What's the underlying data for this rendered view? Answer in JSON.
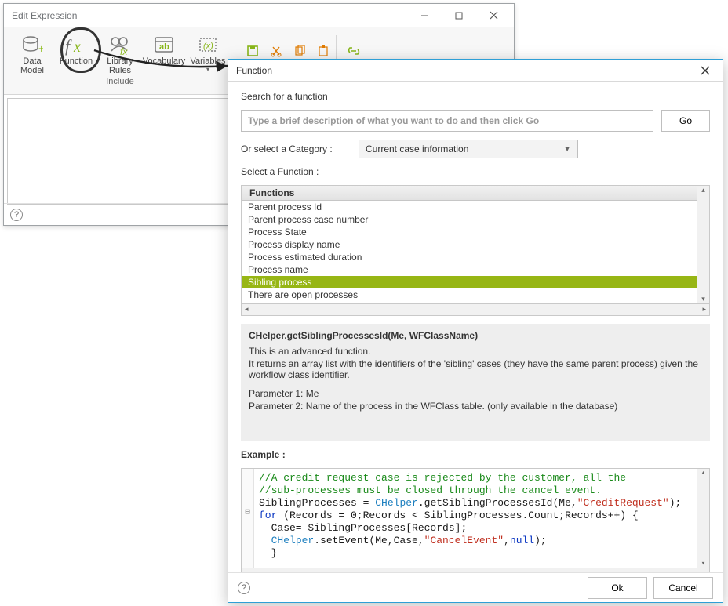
{
  "main_window": {
    "title": "Edit Expression",
    "ribbon_group_label": "Include",
    "items": {
      "data_model": "Data\nModel",
      "function": "Function",
      "library_rules": "Library\nRules",
      "vocabulary": "Vocabulary",
      "variables": "Variables"
    }
  },
  "fn_window": {
    "title": "Function",
    "search_label": "Search for a function",
    "search_placeholder": "Type a brief description of what you want to do and then click Go",
    "go_label": "Go",
    "cat_label": "Or select a Category :",
    "cat_value": "Current case information",
    "select_fn_label": "Select a Function :",
    "list_header": "Functions",
    "functions": [
      "Parent process Id",
      "Parent process case number",
      "Process State",
      "Process display name",
      "Process estimated duration",
      "Process name",
      "Sibling process",
      "There are open processes"
    ],
    "selected_index": 6,
    "desc": {
      "signature": "CHelper.getSiblingProcessesId(Me, WFClassName)",
      "line1": "This is an advanced function.",
      "line2": "It returns an array list with the identifiers of the 'sibling' cases (they have the same parent process) given the workflow class identifier.",
      "param1": "Parameter 1: Me",
      "param2": "Parameter 2: Name of the process in the WFClass table. (only available in the database)"
    },
    "example_label": "Example :",
    "example_code": {
      "c1": "//A credit request case is rejected by the customer, all the",
      "c2": "//sub-processes must be closed through the cancel event.",
      "l3a": "SiblingProcesses = ",
      "l3b": "CHelper",
      "l3c": ".getSiblingProcessesId(Me,",
      "l3d": "\"CreditRequest\"",
      "l3e": ");",
      "l4a": "for",
      "l4b": " (Records = 0;Records < SiblingProcesses.Count;Records++) {",
      "l5": "  Case= SiblingProcesses[Records];",
      "l6a": "  ",
      "l6b": "CHelper",
      "l6c": ".setEvent(Me,Case,",
      "l6d": "\"CancelEvent\"",
      "l6e": ",",
      "l6f": "null",
      "l6g": ");",
      "l7": "  }"
    },
    "ok_label": "Ok",
    "cancel_label": "Cancel"
  }
}
